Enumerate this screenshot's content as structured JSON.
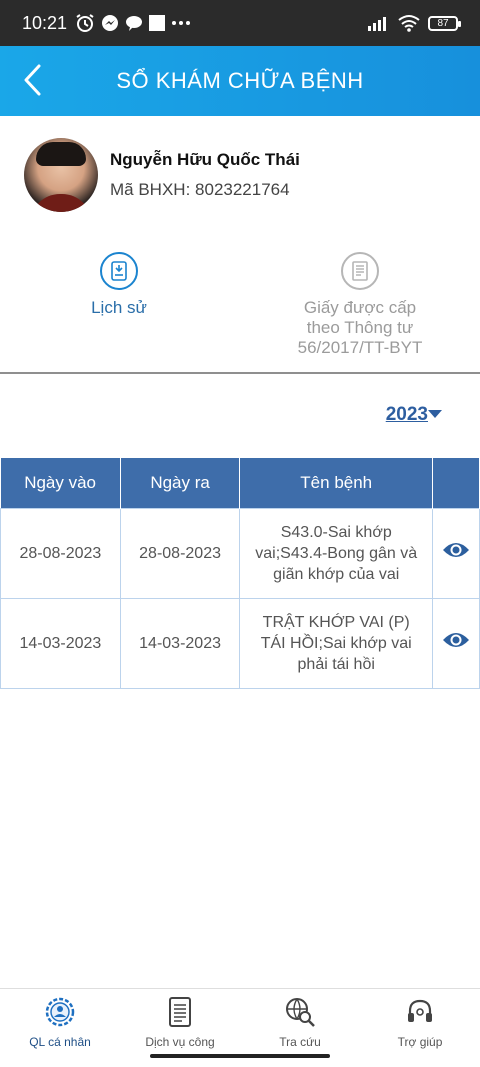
{
  "status_bar": {
    "time": "10:21",
    "battery": "87",
    "icons_left": [
      "alarm-icon",
      "messenger-icon",
      "chat-icon",
      "square-icon",
      "more-icon"
    ],
    "icons_right": [
      "signal-icon",
      "wifi-icon",
      "battery-icon"
    ]
  },
  "header": {
    "title": "SỔ KHÁM CHỮA BỆNH",
    "back_icon": "chevron-left-icon",
    "color": "#1a9de4"
  },
  "profile": {
    "name": "Nguyễn Hữu Quốc Thái",
    "insurance_label": "Mã BHXH:",
    "insurance_number": "8023221764"
  },
  "menu": {
    "history_label": "Lịch sử",
    "certificate_label": "Giấy được cấp theo Thông tư 56/2017/TT-BYT",
    "certificate_lines": [
      "Giấy được cấp",
      "theo Thông tư",
      "56/2017/TT-BYT"
    ]
  },
  "year_filter": {
    "selected": "2023"
  },
  "table": {
    "headers": [
      "Ngày vào",
      "Ngày ra",
      "Tên bệnh",
      ""
    ],
    "rows": [
      {
        "date_in": "28-08-2023",
        "date_out": "28-08-2023",
        "disease": "S43.0-Sai khớp vai;S43.4-Bong gân và giãn khớp của vai"
      },
      {
        "date_in": "14-03-2023",
        "date_out": "14-03-2023",
        "disease": "TRẬT KHỚP VAI (P) TÁI HỒI;Sai khớp vai phải  tái hồi"
      }
    ],
    "header_color": "#3e6daa"
  },
  "bottom_nav": {
    "items": [
      {
        "label": "QL cá nhân",
        "icon": "user-gear-icon"
      },
      {
        "label": "Dịch vụ công",
        "icon": "document-icon"
      },
      {
        "label": "Tra cứu",
        "icon": "globe-search-icon"
      },
      {
        "label": "Trợ giúp",
        "icon": "headset-icon"
      }
    ]
  }
}
